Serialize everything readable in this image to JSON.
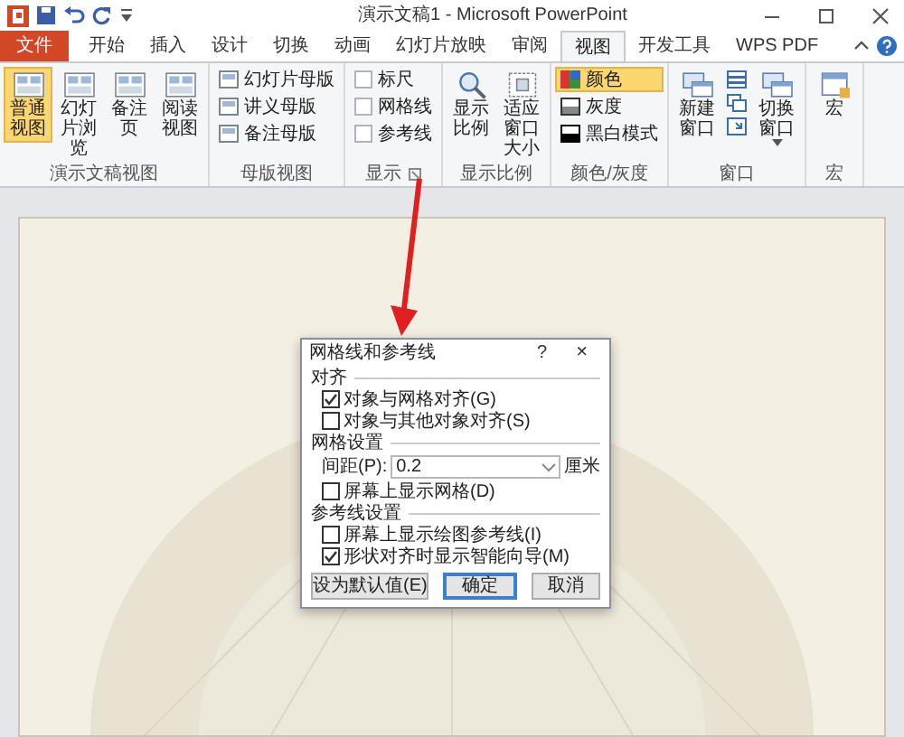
{
  "window": {
    "title": "演示文稿1 - Microsoft PowerPoint"
  },
  "tabs": [
    {
      "label": "文件",
      "kind": "file",
      "selected": false
    },
    {
      "label": "开始",
      "kind": "normal",
      "selected": false
    },
    {
      "label": "插入",
      "kind": "normal",
      "selected": false
    },
    {
      "label": "设计",
      "kind": "normal",
      "selected": false
    },
    {
      "label": "切换",
      "kind": "normal",
      "selected": false
    },
    {
      "label": "动画",
      "kind": "normal",
      "selected": false
    },
    {
      "label": "幻灯片放映",
      "kind": "normal",
      "selected": false
    },
    {
      "label": "审阅",
      "kind": "normal",
      "selected": false
    },
    {
      "label": "视图",
      "kind": "normal",
      "selected": true
    },
    {
      "label": "开发工具",
      "kind": "normal",
      "selected": false
    },
    {
      "label": "WPS PDF",
      "kind": "normal",
      "selected": false
    }
  ],
  "ribbon": {
    "groups": [
      {
        "label": "演示文稿视图",
        "items": [
          {
            "label": "普通视图",
            "kind": "large",
            "selected": true
          },
          {
            "label": "幻灯片浏览",
            "kind": "large",
            "selected": false
          },
          {
            "label": "备注页",
            "kind": "large",
            "selected": false
          },
          {
            "label": "阅读视图",
            "kind": "large",
            "selected": false
          }
        ]
      },
      {
        "label": "母版视图",
        "items": [
          {
            "label": "幻灯片母版",
            "kind": "small"
          },
          {
            "label": "讲义母版",
            "kind": "small"
          },
          {
            "label": "备注母版",
            "kind": "small"
          }
        ]
      },
      {
        "label": "显示",
        "launcher": true,
        "items": [
          {
            "label": "标尺",
            "kind": "check",
            "checked": false
          },
          {
            "label": "网格线",
            "kind": "check",
            "checked": false
          },
          {
            "label": "参考线",
            "kind": "check",
            "checked": false
          }
        ]
      },
      {
        "label": "显示比例",
        "items": [
          {
            "label": "显示比例",
            "kind": "large"
          },
          {
            "label": "适应窗口大小",
            "kind": "large"
          }
        ]
      },
      {
        "label": "颜色/灰度",
        "items": [
          {
            "label": "颜色",
            "kind": "small",
            "selected": true
          },
          {
            "label": "灰度",
            "kind": "small",
            "selected": false
          },
          {
            "label": "黑白模式",
            "kind": "small",
            "selected": false
          }
        ]
      },
      {
        "label": "窗口",
        "items": [
          {
            "label": "新建窗口",
            "kind": "large"
          },
          {
            "kind": "icons"
          },
          {
            "label": "切换窗口",
            "kind": "large",
            "dropdown": true
          }
        ]
      },
      {
        "label": "宏",
        "items": [
          {
            "label": "宏",
            "kind": "large"
          }
        ]
      }
    ]
  },
  "dialog": {
    "title": "网格线和参考线",
    "help": "?",
    "close": "×",
    "sections": [
      {
        "heading": "对齐",
        "rows": [
          {
            "kind": "check",
            "label": "对象与网格对齐(G)",
            "checked": true
          },
          {
            "kind": "check",
            "label": "对象与其他对象对齐(S)",
            "checked": false
          }
        ]
      },
      {
        "heading": "网格设置",
        "rows": [
          {
            "kind": "spacing",
            "label": "间距(P):",
            "value": "0.2",
            "unit": "厘米"
          },
          {
            "kind": "check",
            "label": "屏幕上显示网格(D)",
            "checked": false
          }
        ]
      },
      {
        "heading": "参考线设置",
        "rows": [
          {
            "kind": "check",
            "label": "屏幕上显示绘图参考线(I)",
            "checked": false
          },
          {
            "kind": "check",
            "label": "形状对齐时显示智能向导(M)",
            "checked": true
          }
        ]
      }
    ],
    "buttons": [
      {
        "label": "设为默认值(E)",
        "default": false
      },
      {
        "label": "确定",
        "default": true
      },
      {
        "label": "取消",
        "default": false
      }
    ]
  }
}
